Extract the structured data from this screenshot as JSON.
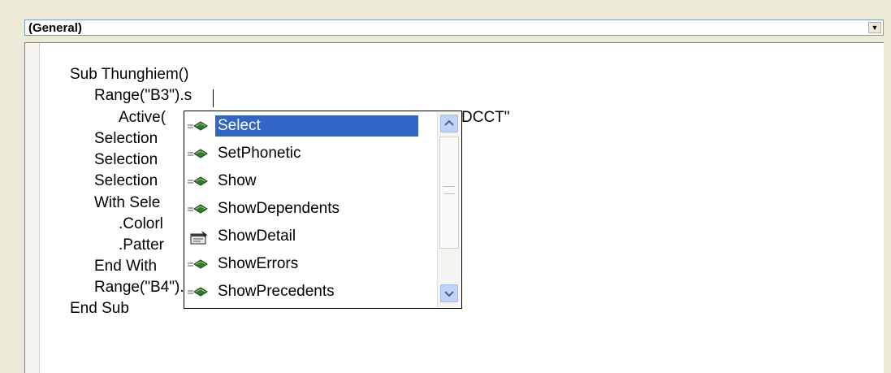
{
  "procedure_combo": {
    "selected": "(General)"
  },
  "code_lines": [
    "Sub Thunghiem()",
    "Range(\"B3\").s",
    "Active(",
    "Selection",
    "Selection",
    "Selection",
    "With Sele",
    ".Colorl",
    ".Patter",
    "End With",
    "Range(\"B4\").Select",
    "End Sub"
  ],
  "code_fragment_right": "DCCT\"",
  "autocomplete": {
    "items": [
      {
        "label": "Select",
        "icon": "method-icon",
        "selected": true
      },
      {
        "label": "SetPhonetic",
        "icon": "method-icon"
      },
      {
        "label": "Show",
        "icon": "method-icon"
      },
      {
        "label": "ShowDependents",
        "icon": "method-icon"
      },
      {
        "label": "ShowDetail",
        "icon": "property-icon"
      },
      {
        "label": "ShowErrors",
        "icon": "method-icon"
      },
      {
        "label": "ShowPrecedents",
        "icon": "method-icon"
      }
    ]
  },
  "colors": {
    "selection": "#3166c6",
    "method_icon": "#2e7d32"
  }
}
